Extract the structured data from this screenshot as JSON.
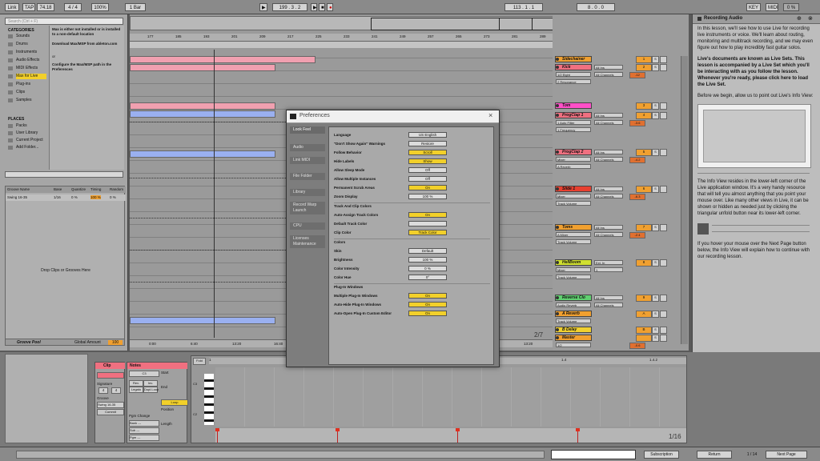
{
  "topbar": {
    "link": "Link",
    "tap": "TAP",
    "tempo": "74.18",
    "signature": "4 / 4",
    "zoom": "100%",
    "bar": "1 Bar",
    "position": "199 . 3 . 2",
    "loop_start": "113 . 1 . 1",
    "loop_len": "8 . 0 . 0",
    "key": "KEY",
    "midi": "MIDI",
    "cpu": "0 %"
  },
  "browser": {
    "search_placeholder": "Search (Ctrl + F)",
    "categories_label": "CATEGORIES",
    "categories": [
      "Sounds",
      "Drums",
      "Instruments",
      "Audio Effects",
      "MIDI Effects",
      "Max for Live",
      "Plug-ins",
      "Clips",
      "Samples"
    ],
    "places_label": "PLACES",
    "places": [
      "Packs",
      "User Library",
      "Current Project",
      "Add Folder..."
    ],
    "max_msg_1": "Max is either not installed or is installed to a non-default location",
    "max_msg_2": "Download Max/MSP from ableton.com",
    "max_msg_3": "or",
    "max_msg_4": "Configure the Max/MSP path in the Preferences",
    "groove_headers": [
      "Groove Name",
      "Base",
      "Quantize",
      "Timing",
      "Random"
    ],
    "groove_row": [
      "Swing 16-35",
      "1/16",
      "0 %",
      "100 %",
      "0 %"
    ],
    "drop_hint": "Drop Clips or Grooves Here",
    "groove_pool": "Groove Pool",
    "global_amount_label": "Global Amount",
    "global_amount": "100"
  },
  "ruler": [
    "177",
    "185",
    "193",
    "201",
    "209",
    "217",
    "225",
    "233",
    "241",
    "249",
    "257",
    "265",
    "273",
    "281",
    "289"
  ],
  "timeline": [
    "0:00",
    "6:40",
    "13:20",
    "16:40",
    "20:00",
    "23:20",
    "3:00",
    "5:00",
    "10:00",
    "13:20"
  ],
  "tracks": [
    {
      "name": "Sidechainer",
      "color": "#f0a030",
      "num": "1",
      "value": ""
    },
    {
      "name": "Kick",
      "color": "#f07080",
      "num": "2",
      "value": "-12",
      "io": "1/2 Eight",
      "route": "All Ins",
      "ch": "All Channels",
      "ins": "2 Resonance",
      "mon": "In Auto Off"
    },
    {
      "name": "Tom",
      "color": "#ff50c8",
      "num": "3",
      "value": ""
    },
    {
      "name": "ProgClap 1",
      "color": "#f07080",
      "num": "4",
      "value": "-3.6",
      "io": "1 Auto Filter",
      "route": "All Ins",
      "ch": "All Channels",
      "ins": "1 Frequency"
    },
    {
      "name": "ProgClap 2",
      "color": "#f07080",
      "num": "5",
      "value": "-4.2",
      "io": "Mixer",
      "route": "All Ins",
      "ch": "All Channels",
      "ins": "A Reverb"
    },
    {
      "name": "Slide 1",
      "color": "#e84030",
      "num": "6",
      "value": "-6.3",
      "io": "Mixer",
      "route": "All Ins",
      "ch": "All Channels",
      "ins": "Track Volume"
    },
    {
      "name": "Toms",
      "color": "#f0a030",
      "num": "7",
      "value": "-2.4",
      "io": "A Mixer",
      "route": "All Ins",
      "ch": "All Channels",
      "ins": "Track Volume"
    },
    {
      "name": "HellBoom",
      "color": "#d0e030",
      "num": "8",
      "value": "",
      "io": "Mixer",
      "route": "Ext. In",
      "ch": "1",
      "ins": "Track Volume"
    },
    {
      "name": "Reverse Clo",
      "color": "#60d070",
      "num": "9",
      "value": "",
      "io": "Audio Reverb",
      "route": "All Ins",
      "ch": "All Channels"
    },
    {
      "name": "A Reverb",
      "color": "#f0a030",
      "num": "A",
      "value": "",
      "io": "Track Volume"
    },
    {
      "name": "B Delay",
      "color": "#f0d030",
      "num": "B",
      "value": ""
    },
    {
      "name": "Master",
      "color": "#f0a030",
      "num": "",
      "value": "-0.6",
      "io": "1/2"
    }
  ],
  "page_indicator": "2/7",
  "info": {
    "title": "Recording Audio",
    "p1": "In this lesson, we'll see how to use Live for recording live instruments or voice. We'll learn about routing, monitoring and multitrack recording, and we may even figure out how to play incredibly fast guitar solos.",
    "p2": "Live's documents are known as Live Sets. This lesson is accompanied by a Live Set which you'll be interacting with as you follow the lesson. Whenever you're ready, please click here to load the Live Set.",
    "p3": "Before we begin, allow us to point out Live's Info View:",
    "p4": "The Info View resides in the lower-left corner of the Live application window. It's a very handy resource that will tell you almost anything that you point your mouse over. Like many other views in Live, it can be shown or hidden as needed just by clicking the triangular unfold button near its lower-left corner.",
    "p5": "If you hover your mouse over the Next Page button below, the Info View will explain how to continue with our recording lesson.",
    "return": "Return",
    "pages": "1 / 14",
    "next": "Next Page"
  },
  "clip_view": {
    "clip_label": "Clip",
    "notes_label": "Notes",
    "signature_label": "Signature",
    "sig_num": "4",
    "sig_den": "4",
    "groove_label": "Groove",
    "groove_value": "Swing 16-35",
    "commit": "Commit",
    "start_label": "Start",
    "end_label": "End",
    "loop": "Loop",
    "position_label": "Position",
    "length_label": "Length",
    "pgm_change": "Pgm Change",
    "bank": "Bank ---",
    "sub": "Sub ---",
    "pgm": "Pgm ---",
    "fold": "Fold",
    "notes_c3": "C3",
    "notes_c2": "C2",
    "ratio": "1/16",
    "ruler": [
      "1",
      "1.1.2",
      "1.2",
      "1.3",
      "1.4",
      "1.4.2"
    ],
    "extra_buttons": [
      "Rev.",
      "Inv.",
      "Legato",
      "Dupl.Loop"
    ]
  },
  "preferences": {
    "title": "Preferences",
    "tabs": [
      "Look Feel",
      "Audio",
      "Link MIDI",
      "File Folder",
      "Library",
      "Record Warp Launch",
      "CPU",
      "Licenses Maintenance"
    ],
    "rows": [
      {
        "label": "Language",
        "value": "US English",
        "yellow": false
      },
      {
        "label": "\"Don't Show Again\" Warnings",
        "value": "Restore",
        "yellow": false
      },
      {
        "label": "Follow Behavior",
        "value": "Scroll",
        "yellow": true
      },
      {
        "label": "Hide Labels",
        "value": "Show",
        "yellow": true
      },
      {
        "label": "Allow Sleep Mode",
        "value": "Off",
        "yellow": false
      },
      {
        "label": "Allow Multiple Instances",
        "value": "Off",
        "yellow": false
      },
      {
        "label": "Permanent Scrub Areas",
        "value": "On",
        "yellow": true
      },
      {
        "label": "Zoom Display",
        "value": "100 %",
        "yellow": false
      }
    ],
    "section_colors": "Track And Clip Colors",
    "rows2": [
      {
        "label": "Auto-Assign Track Colors",
        "value": "On",
        "yellow": true
      },
      {
        "label": "Default Track Color",
        "value": "",
        "yellow": false
      },
      {
        "label": "Clip Color",
        "value": "Track Color",
        "yellow": true
      }
    ],
    "section_colors2": "Colors",
    "rows3": [
      {
        "label": "Skin",
        "value": "Default",
        "yellow": false
      },
      {
        "label": "Brightness",
        "value": "100 %",
        "yellow": false
      },
      {
        "label": "Color Intensity",
        "value": "0 %",
        "yellow": false
      },
      {
        "label": "Color Hue",
        "value": "0°",
        "yellow": false
      }
    ],
    "section_plugin": "Plug-In Windows",
    "rows4": [
      {
        "label": "Multiple Plug-In Windows",
        "value": "On",
        "yellow": true
      },
      {
        "label": "Auto-Hide Plug-In Windows",
        "value": "On",
        "yellow": true
      },
      {
        "label": "Auto-Open Plug-In Custom Editor",
        "value": "On",
        "yellow": true
      }
    ]
  },
  "status": {
    "label": "Subscription"
  }
}
